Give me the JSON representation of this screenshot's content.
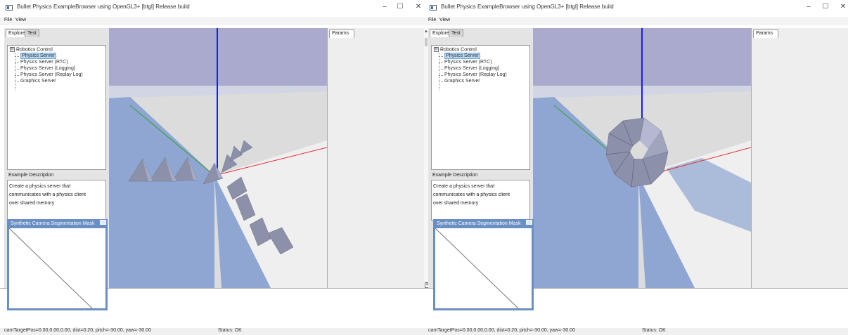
{
  "windows": [
    {
      "title": "Bullet Physics ExampleBrowser using OpenGL3+ [btgl] Release build",
      "controls": {
        "minimize": "–",
        "maximize": "☐",
        "close": "✕"
      },
      "menu": [
        "File",
        "View"
      ],
      "tabs": [
        "Explorer",
        "Test"
      ],
      "tree": {
        "root": "Robotics Control",
        "toggle": "⊟",
        "items": [
          "Physics Server",
          "Physics Server (RTC)",
          "Physics Server (Logging)",
          "Physics Server (Replay Log)",
          "Graphics Server"
        ],
        "selected_index": 0
      },
      "description_title": "Example Description",
      "description_lines": [
        "Create a physics server that",
        "communicates with a physics client",
        "over shared memory"
      ],
      "params_tab": "Params",
      "camera_window_title": "Synthetic Camera Segmentation Mask",
      "status_left": "camTargetPos=0.00,0.00,0.00, dist=0.20, pitch=-30.00, yaw=-30.00",
      "status_right": "Status: OK"
    },
    {
      "title": "Bullet Physics ExampleBrowser using OpenGL3+ [btgl] Release build",
      "controls": {
        "minimize": "–",
        "maximize": "☐",
        "close": "✕"
      },
      "menu": [
        "File",
        "View"
      ],
      "tabs": [
        "Explorer",
        "Test"
      ],
      "tree": {
        "root": "Robotics Control",
        "toggle": "⊟",
        "items": [
          "Physics Server",
          "Physics Server (RTC)",
          "Physics Server (Logging)",
          "Physics Server (Replay Log)",
          "Graphics Server"
        ],
        "selected_index": 0
      },
      "description_title": "Example Description",
      "description_lines": [
        "Create a physics server that",
        "communicates with a physics client",
        "over shared memory"
      ],
      "params_tab": "Params",
      "camera_window_title": "Synthetic Camera Segmentation Mask",
      "status_left": "camTargetPos=0.00,0.00,0.00, dist=0.20, pitch=-30.00, yaw=-30.00",
      "status_right": "Status: OK",
      "scroll_up_arrow": "▲",
      "expand_toggle": "⊞"
    }
  ],
  "colors": {
    "sky": "#a9aacd",
    "ground": "#dcdcdc",
    "floor_shadow": "#8fa6d2",
    "z_axis": "#1a1aff",
    "x_axis": "#e03030",
    "y_axis": "#30a030",
    "camera_window": "#6a8fc5"
  }
}
